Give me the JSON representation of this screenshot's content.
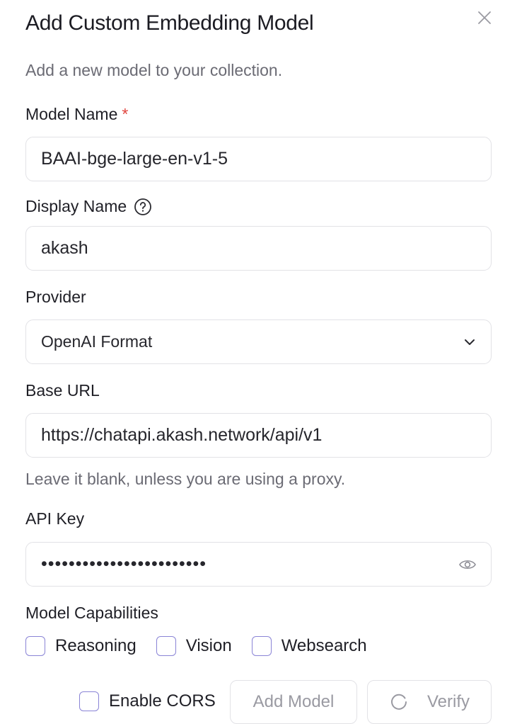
{
  "dialog": {
    "title": "Add Custom Embedding Model",
    "subtitle": "Add a new model to your collection.",
    "close_icon": "close-icon"
  },
  "fields": {
    "model_name": {
      "label": "Model Name",
      "required_mark": "*",
      "value": "BAAI-bge-large-en-v1-5"
    },
    "display_name": {
      "label": "Display Name",
      "help_icon": "question-circle-icon",
      "value": "akash"
    },
    "provider": {
      "label": "Provider",
      "value": "OpenAI Format",
      "icon": "chevron-down-icon"
    },
    "base_url": {
      "label": "Base URL",
      "value": "https://chatapi.akash.network/api/v1",
      "hint": "Leave it blank, unless you are using a proxy."
    },
    "api_key": {
      "label": "API Key",
      "value": "••••••••••••••••••••••••",
      "icon": "eye-icon"
    }
  },
  "capabilities": {
    "label": "Model Capabilities",
    "items": [
      {
        "label": "Reasoning",
        "checked": false
      },
      {
        "label": "Vision",
        "checked": false
      },
      {
        "label": "Websearch",
        "checked": false
      }
    ]
  },
  "footer": {
    "cors_label": "Enable CORS",
    "cors_checked": false,
    "add_label": "Add Model",
    "verify_label": "Verify",
    "verify_icon": "spinner-icon"
  },
  "colors": {
    "checkbox_border": "#8a84d6",
    "required": "#e0443e",
    "muted_text": "#6b6b74",
    "disabled_text": "#9a9aa2"
  }
}
